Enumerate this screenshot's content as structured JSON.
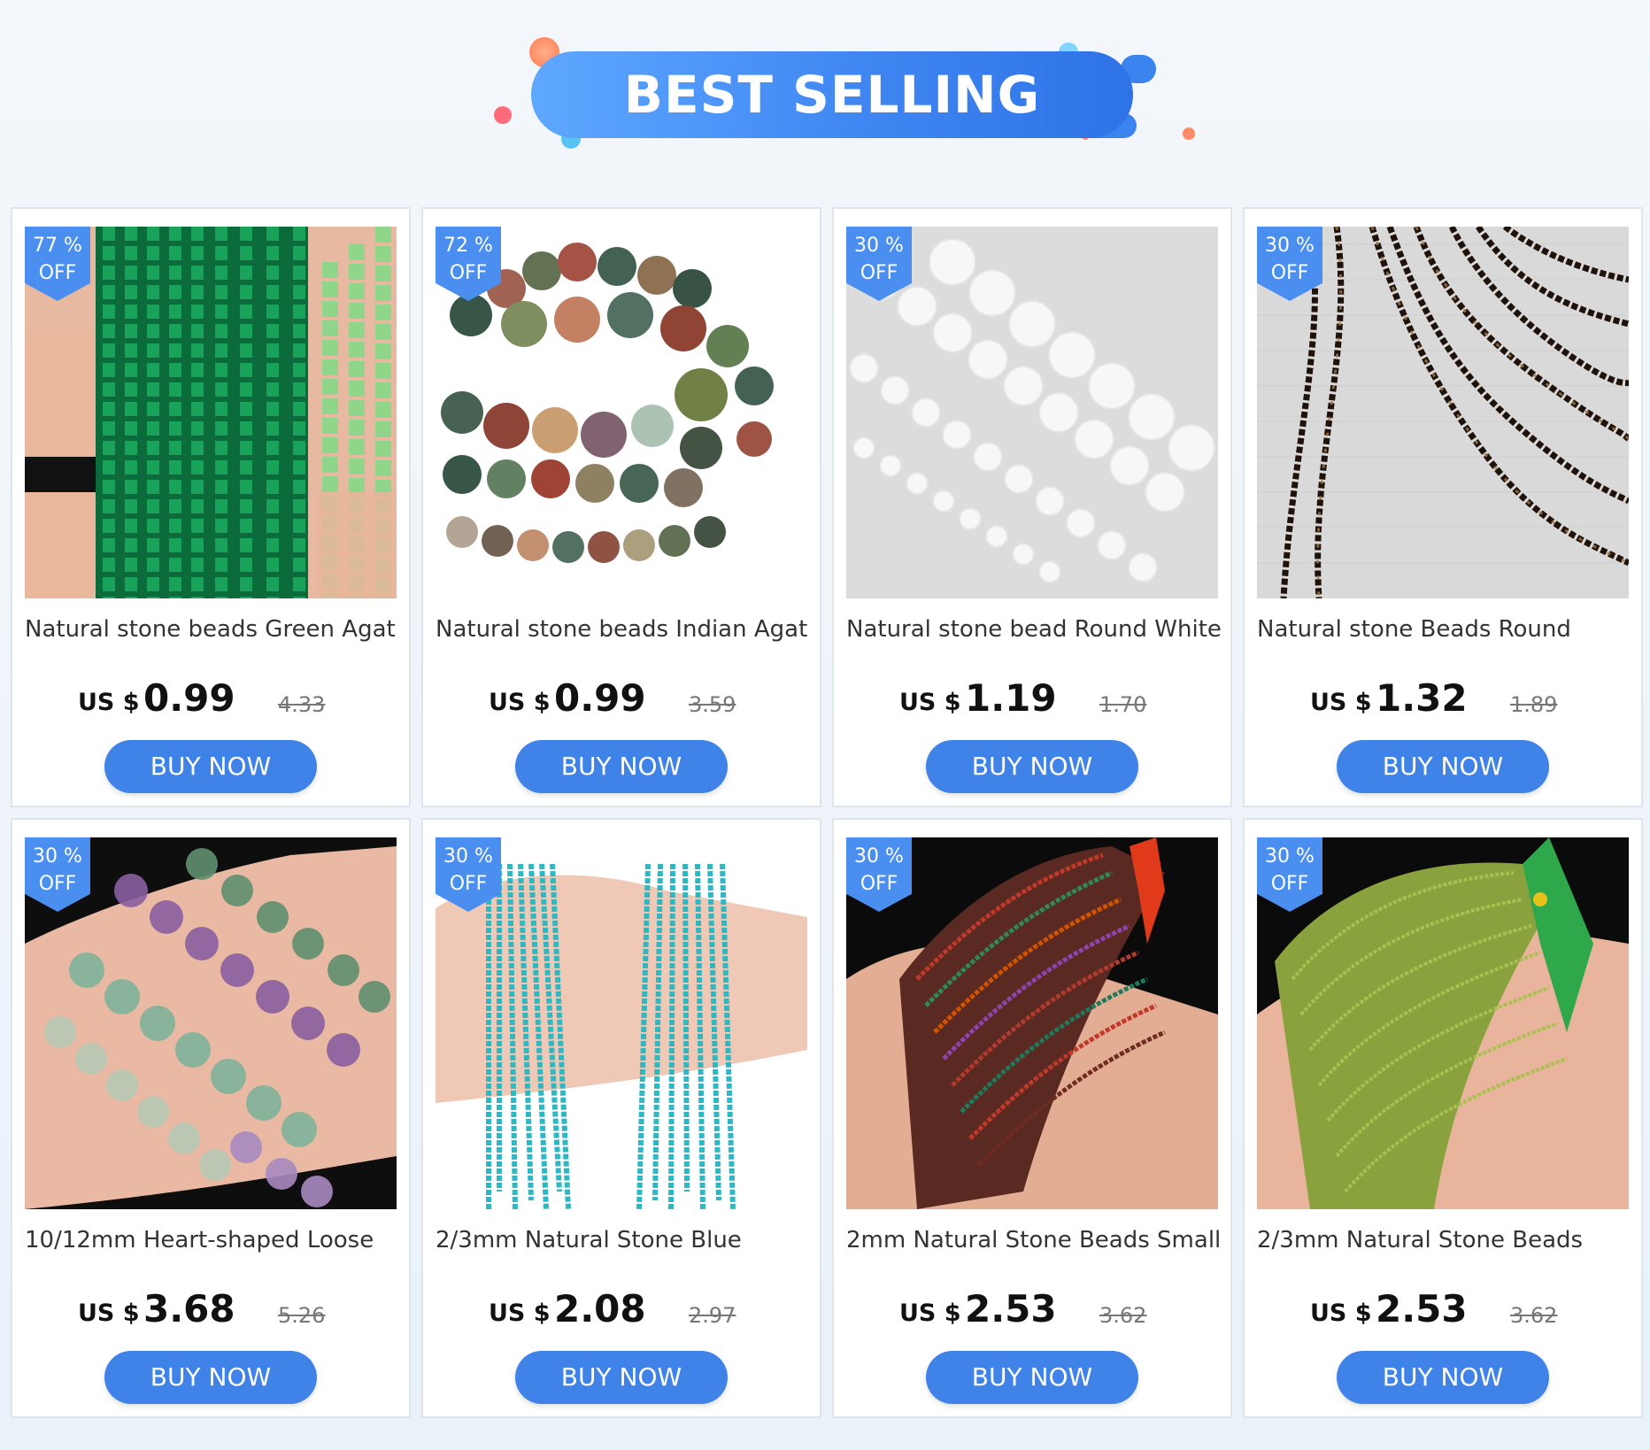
{
  "banner": {
    "title": "BEST SELLING"
  },
  "colors": {
    "accent": "#3f82e8",
    "badge": "#4a8ef0",
    "banner": "#3f86f2"
  },
  "products": [
    {
      "discount_pct": "77 %",
      "discount_off": "OFF",
      "title": "Natural stone beads Green Agat",
      "currency": "US $",
      "price": "0.99",
      "original_price": "4.33",
      "buy_label": "BUY NOW",
      "image": "green-agate-beads"
    },
    {
      "discount_pct": "72 %",
      "discount_off": "OFF",
      "title": "Natural stone beads Indian Agat",
      "currency": "US $",
      "price": "0.99",
      "original_price": "3.59",
      "buy_label": "BUY NOW",
      "image": "indian-agate-beads"
    },
    {
      "discount_pct": "30 %",
      "discount_off": "OFF",
      "title": "Natural stone bead Round White",
      "currency": "US $",
      "price": "1.19",
      "original_price": "1.70",
      "buy_label": "BUY NOW",
      "image": "white-round-beads"
    },
    {
      "discount_pct": "30 %",
      "discount_off": "OFF",
      "title": "Natural stone Beads Round",
      "currency": "US $",
      "price": "1.32",
      "original_price": "1.89",
      "buy_label": "BUY NOW",
      "image": "striped-agate-beads"
    },
    {
      "discount_pct": "30 %",
      "discount_off": "OFF",
      "title": "10/12mm Heart-shaped Loose",
      "currency": "US $",
      "price": "3.68",
      "original_price": "5.26",
      "buy_label": "BUY NOW",
      "image": "heart-fluorite-beads"
    },
    {
      "discount_pct": "30 %",
      "discount_off": "OFF",
      "title": "2/3mm Natural Stone Blue",
      "currency": "US $",
      "price": "2.08",
      "original_price": "2.97",
      "buy_label": "BUY NOW",
      "image": "turquoise-beads"
    },
    {
      "discount_pct": "30 %",
      "discount_off": "OFF",
      "title": "2mm Natural Stone Beads Small",
      "currency": "US $",
      "price": "2.53",
      "original_price": "3.62",
      "buy_label": "BUY NOW",
      "image": "mixed-agate-beads"
    },
    {
      "discount_pct": "30 %",
      "discount_off": "OFF",
      "title": "2/3mm Natural Stone Beads",
      "currency": "US $",
      "price": "2.53",
      "original_price": "3.62",
      "buy_label": "BUY NOW",
      "image": "peridot-beads"
    }
  ]
}
